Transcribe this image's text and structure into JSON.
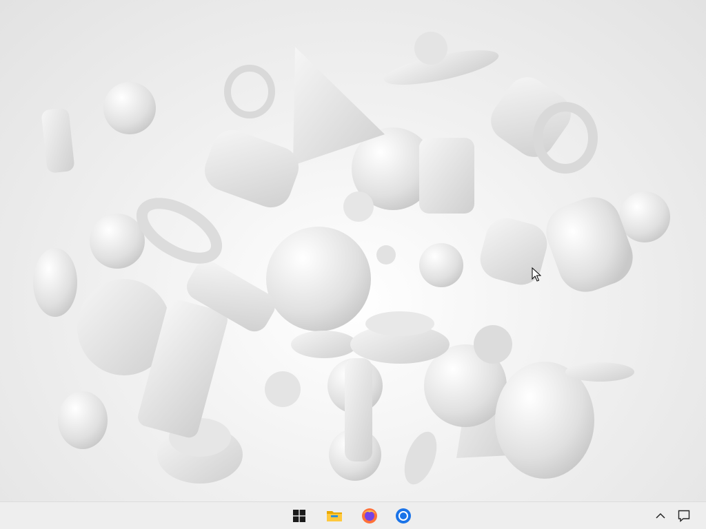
{
  "desktop": {
    "wallpaper": "abstract-white-3d-shapes",
    "cursor": "arrow-cursor"
  },
  "taskbar": {
    "items": [
      {
        "icon": "windows-start-icon",
        "color": "#1a1a1a"
      },
      {
        "icon": "file-explorer-icon",
        "color": "#f4b400"
      },
      {
        "icon": "firefox-icon",
        "color": "#ff7139"
      },
      {
        "icon": "chrome-icon",
        "color": "#1a73e8"
      }
    ],
    "tray": [
      {
        "icon": "show-hidden-icons-chevron"
      },
      {
        "icon": "notification-center-icon"
      }
    ]
  }
}
